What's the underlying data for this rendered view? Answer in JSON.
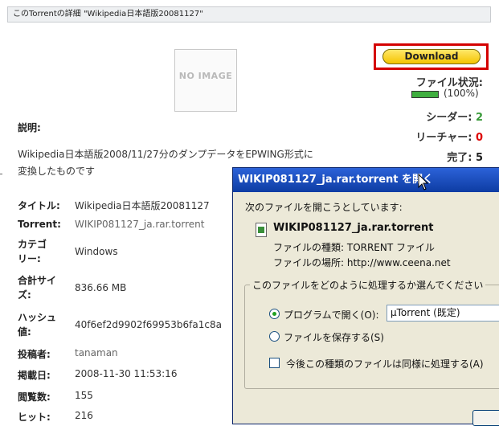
{
  "page": {
    "title": "このTorrentの詳細 \"Wikipedia日本語版20081127\"",
    "no_image": "NO IMAGE"
  },
  "download": {
    "label": "Download"
  },
  "status": {
    "file_status_label": "ファイル状況:",
    "progress": 1.0,
    "progress_text": "(100%)",
    "seeders_label": "シーダー:",
    "seeders": "2",
    "leechers_label": "リーチャー:",
    "leechers": "0",
    "completed_label": "完了:",
    "completed": "5"
  },
  "description": {
    "label": "説明:",
    "line1": "Wikipedia日本語版2008/11/27分のダンプデータをEPWING形式に",
    "line2": "変換したものです"
  },
  "details": {
    "title_label": "タイトル:",
    "title_value": "Wikipedia日本語版20081127",
    "torrent_label": "Torrent:",
    "torrent_value": "WIKIP081127_ja.rar.torrent",
    "category_label_1": "カテゴ",
    "category_label_2": "リー:",
    "category_value": "Windows",
    "size_label_1": "合計サイ",
    "size_label_2": "ズ:",
    "size_value": "836.66 MB",
    "hash_label_1": "ハッシュ",
    "hash_label_2": "値:",
    "hash_value": "40f6ef2d9902f69953b6fa1c8a",
    "poster_label": "投稿者:",
    "poster_value": "tanaman",
    "date_label": "掲載日:",
    "date_value": "2008-11-30 11:53:16",
    "views_label": "閲覧数:",
    "views_value": "155",
    "hits_label": "ヒット:",
    "hits_value": "216"
  },
  "dialog": {
    "title": "WIKIP081127_ja.rar.torrent を開く",
    "intro": "次のファイルを開こうとしています:",
    "filename": "WIKIP081127_ja.rar.torrent",
    "type_text": "ファイルの種類: TORRENT ファイル",
    "location_text": "ファイルの場所: http://www.ceena.net",
    "group_label": "このファイルをどのように処理するか選んでください",
    "open_with_label": "プログラムで開く(O):",
    "open_with_value": "µTorrent (既定)",
    "save_label": "ファイルを保存する(S)",
    "remember_label": "今後この種類のファイルは同様に処理する(A)"
  }
}
